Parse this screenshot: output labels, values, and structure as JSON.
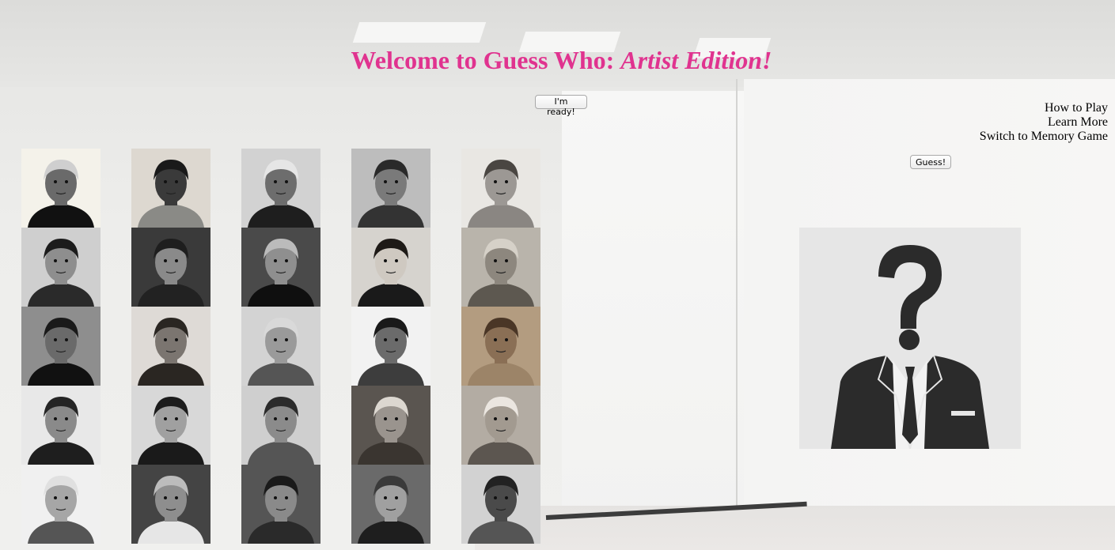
{
  "title": {
    "main": "Welcome to Guess Who: ",
    "emphasis": "Artist Edition!"
  },
  "buttons": {
    "ready": "I'm ready!",
    "guess": "Guess!"
  },
  "menu": [
    "How to Play",
    "Learn More",
    "Switch to Memory Game"
  ],
  "portraits": [
    {
      "bg": "#f4f2ea",
      "skin": "#6a6a6a",
      "hair": "#cfcfcf",
      "cloth": "#111"
    },
    {
      "bg": "#ddd8d0",
      "skin": "#3a3a3a",
      "hair": "#1a1a1a",
      "cloth": "#8a8a86"
    },
    {
      "bg": "#d2d2d2",
      "skin": "#6d6d6d",
      "hair": "#e6e6e6",
      "cloth": "#1e1e1e"
    },
    {
      "bg": "#bdbdbd",
      "skin": "#7a7a7a",
      "hair": "#2a2a2a",
      "cloth": "#333"
    },
    {
      "bg": "#e9e7e3",
      "skin": "#9c9894",
      "hair": "#4a4642",
      "cloth": "#8a8682"
    },
    {
      "bg": "#cfcfcf",
      "skin": "#8e8e8e",
      "hair": "#1c1c1c",
      "cloth": "#2a2a2a"
    },
    {
      "bg": "#3a3a3a",
      "skin": "#8a8a8a",
      "hair": "#1e1e1e",
      "cloth": "#222"
    },
    {
      "bg": "#4a4a4a",
      "skin": "#8f8f8f",
      "hair": "#bbbbbb",
      "cloth": "#0f0f0f"
    },
    {
      "bg": "#d6d3ce",
      "skin": "#cfc9c1",
      "hair": "#1e1a17",
      "cloth": "#1a1a1a"
    },
    {
      "bg": "#b9b4ab",
      "skin": "#8d877e",
      "hair": "#d6d1c8",
      "cloth": "#5d5850"
    },
    {
      "bg": "#8e8e8e",
      "skin": "#6a6a6a",
      "hair": "#1a1a1a",
      "cloth": "#111"
    },
    {
      "bg": "#dedad6",
      "skin": "#7b7570",
      "hair": "#2a2622",
      "cloth": "#2a2622"
    },
    {
      "bg": "#d3d3d3",
      "skin": "#9a9a9a",
      "hair": "#d9d9d9",
      "cloth": "#555"
    },
    {
      "bg": "#f2f2f2",
      "skin": "#6b6b6b",
      "hair": "#1a1a1a",
      "cloth": "#3d3d3d"
    },
    {
      "bg": "#b39c80",
      "skin": "#8a6f55",
      "hair": "#4a3626",
      "cloth": "#9c8468"
    },
    {
      "bg": "#e8e8e8",
      "skin": "#8a8a8a",
      "hair": "#252525",
      "cloth": "#1e1e1e"
    },
    {
      "bg": "#d8d8d8",
      "skin": "#a0a0a0",
      "hair": "#1c1c1c",
      "cloth": "#1a1a1a"
    },
    {
      "bg": "#cfcfcf",
      "skin": "#8b8b8b",
      "hair": "#2b2b2b",
      "cloth": "#555"
    },
    {
      "bg": "#5a5550",
      "skin": "#9a948e",
      "hair": "#dcd7d0",
      "cloth": "#3a3530"
    },
    {
      "bg": "#b3aca3",
      "skin": "#a29a90",
      "hair": "#ebe6e0",
      "cloth": "#5c5650"
    },
    {
      "bg": "#f0f0f0",
      "skin": "#a6a6a6",
      "hair": "#e0e0e0",
      "cloth": "#555"
    },
    {
      "bg": "#444",
      "skin": "#8e8e8e",
      "hair": "#bcbcbc",
      "cloth": "#e6e6e6"
    },
    {
      "bg": "#555",
      "skin": "#8a8a8a",
      "hair": "#1a1a1a",
      "cloth": "#2a2a2a"
    },
    {
      "bg": "#6a6a6a",
      "skin": "#a0a0a0",
      "hair": "#3a3a3a",
      "cloth": "#1e1e1e"
    },
    {
      "bg": "#d2d2d2",
      "skin": "#4a4a4a",
      "hair": "#222",
      "cloth": "#555"
    }
  ]
}
